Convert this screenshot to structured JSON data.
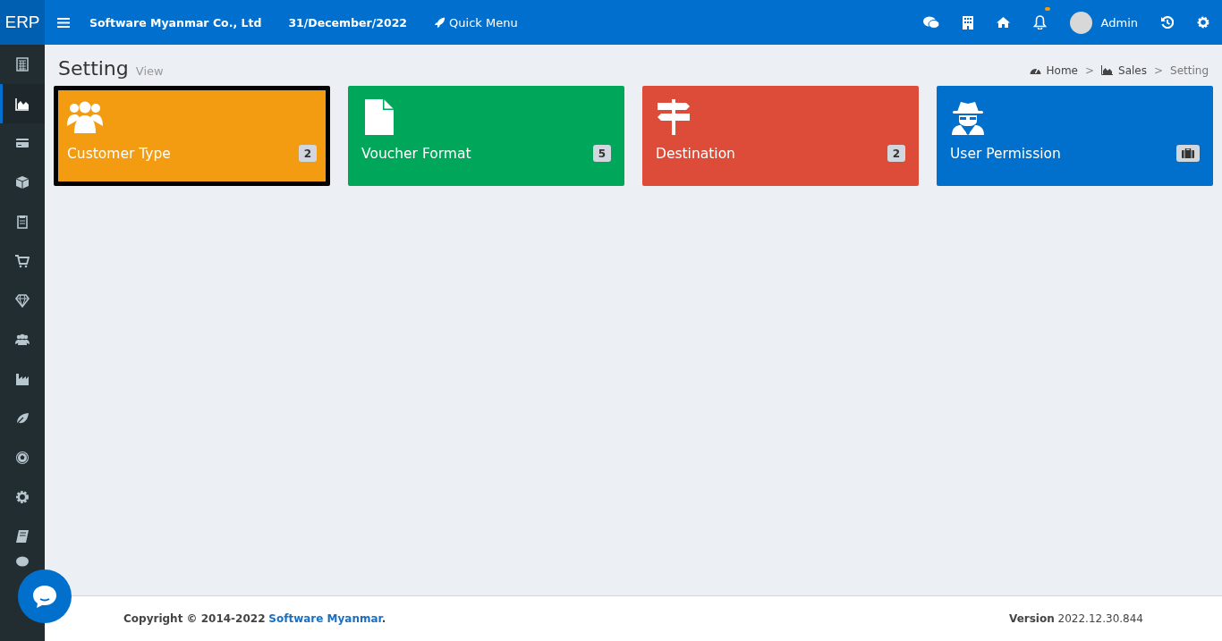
{
  "header": {
    "logo": "ERP",
    "company": "Software Myanmar Co., Ltd",
    "date": "31/December/2022",
    "quick_menu": "Quick Menu",
    "user": "Admin",
    "notification_dot": true
  },
  "sidebar": {
    "items": [
      {
        "selected": false
      },
      {
        "selected": true
      },
      {
        "selected": false
      },
      {
        "selected": false
      },
      {
        "selected": false
      },
      {
        "selected": false
      },
      {
        "selected": false
      },
      {
        "selected": false
      },
      {
        "selected": false
      },
      {
        "selected": false
      },
      {
        "selected": false
      },
      {
        "selected": false
      },
      {
        "selected": false
      },
      {
        "selected": false
      }
    ]
  },
  "page": {
    "title": "Setting",
    "subtitle": "View"
  },
  "breadcrumb": {
    "items": [
      "Home",
      "Sales",
      "Setting"
    ],
    "separators": [
      ">",
      ">"
    ]
  },
  "tiles": [
    {
      "title": "Customer Type",
      "kind": "count",
      "badge": "2",
      "color": "#f39c12",
      "selected": true
    },
    {
      "title": "Voucher Format",
      "kind": "count",
      "badge": "5",
      "color": "#00a65a",
      "selected": false
    },
    {
      "title": "Destination",
      "kind": "count",
      "badge": "2",
      "color": "#dd4b39",
      "selected": false
    },
    {
      "title": "User Permission",
      "kind": "icon",
      "color": "#0070cc",
      "selected": false
    }
  ],
  "footer": {
    "copyright": "**Copyright © 2014-2022**",
    "link": "Software Myanmar",
    "end": "**.**",
    "version": "**Version** 2022.12.30.844"
  }
}
